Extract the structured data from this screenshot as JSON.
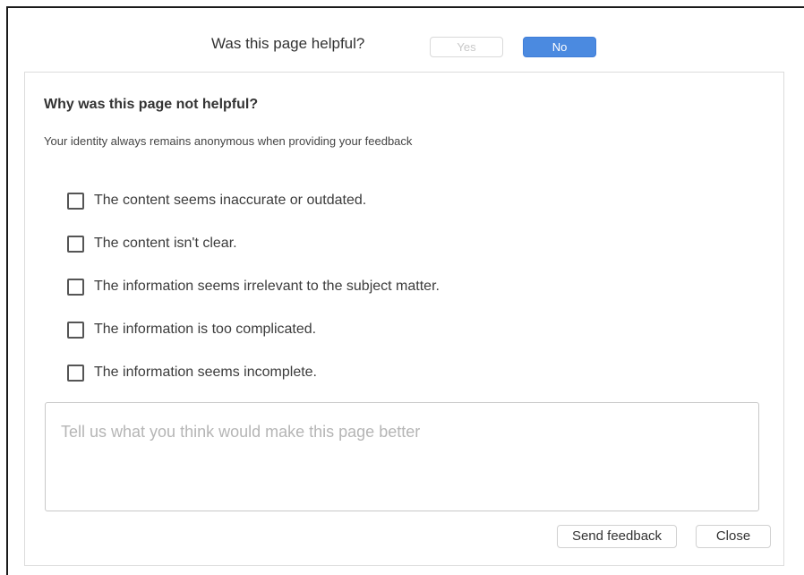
{
  "helpful": {
    "question": "Was this page helpful?",
    "yes_label": "Yes",
    "no_label": "No",
    "selected": "No"
  },
  "feedback": {
    "title": "Why was this page not helpful?",
    "subtitle": "Your identity always remains anonymous when providing your feedback",
    "options": [
      {
        "label": "The content seems inaccurate or outdated.",
        "checked": false
      },
      {
        "label": "The content isn't clear.",
        "checked": false
      },
      {
        "label": "The information seems irrelevant to the subject matter.",
        "checked": false
      },
      {
        "label": "The information is too complicated.",
        "checked": false
      },
      {
        "label": "The information seems incomplete.",
        "checked": false
      }
    ],
    "comment_placeholder": "Tell us what you think would make this page better",
    "comment_value": "",
    "send_label": "Send feedback",
    "close_label": "Close"
  },
  "colors": {
    "accent": "#4b8ae0",
    "disabled_text": "#c8c8c8",
    "border": "#dcdcdc"
  }
}
